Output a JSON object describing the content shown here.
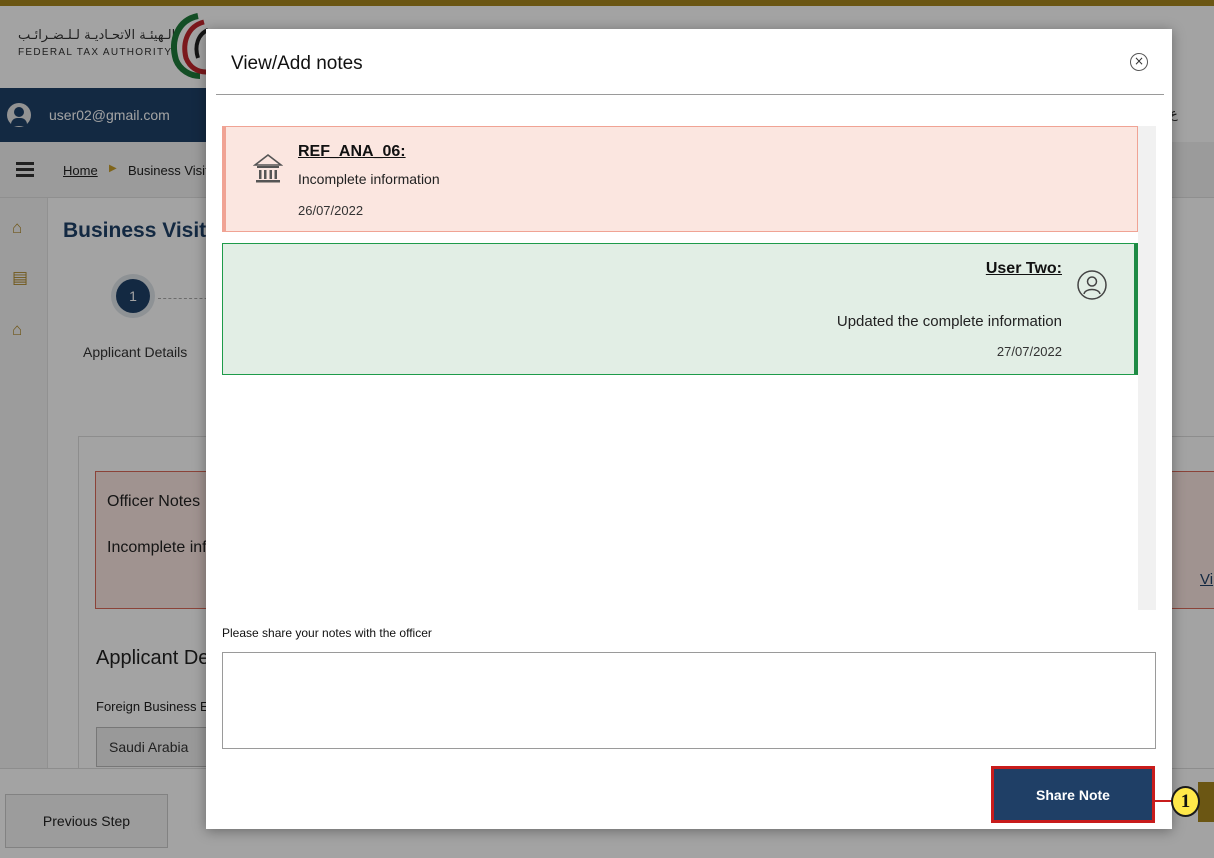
{
  "header": {
    "logo_arabic": "الـهيئـة الاتحـاديـة لـلـضـرائـب",
    "logo_english": "FEDERAL TAX AUTHORITY"
  },
  "userbar": {
    "email": "user02@gmail.com",
    "language_toggle": "ع"
  },
  "breadcrumb": {
    "home": "Home",
    "current": "Business Visit"
  },
  "page": {
    "title": "Business Visitor",
    "step_number": "1",
    "step_label": "Applicant Details",
    "officer_notes_title": "Officer Notes",
    "officer_notes_text": "Incomplete inf",
    "officer_notes_link": "Vi",
    "applicant_heading": "Applicant Det",
    "foreign_label": "Foreign Business E",
    "country_value": "Saudi Arabia"
  },
  "footer": {
    "previous_step": "Previous Step"
  },
  "modal": {
    "title": "View/Add notes",
    "close_symbol": "×",
    "notes": [
      {
        "author": "REF_ANA_06:",
        "text": "Incomplete information",
        "date": "26/07/2022"
      },
      {
        "author": "User Two:",
        "text": "Updated the complete information",
        "date": "27/07/2022"
      }
    ],
    "share_label": "Please share your notes with the officer",
    "textarea_value": "",
    "share_button": "Share Note"
  },
  "annotation": {
    "callout_number": "1"
  },
  "colors": {
    "navy": "#1f4168",
    "gold": "#a8871f",
    "officer_note_bg": "#fbe6e0",
    "user_note_bg": "#e2eee5",
    "user_note_accent": "#1e8a44",
    "highlight_red": "#c81c1c",
    "callout_yellow": "#ffe84a"
  },
  "icons": {
    "close": "close-icon",
    "officer": "bank-icon",
    "user": "person-icon",
    "menu": "hamburger-icon"
  }
}
